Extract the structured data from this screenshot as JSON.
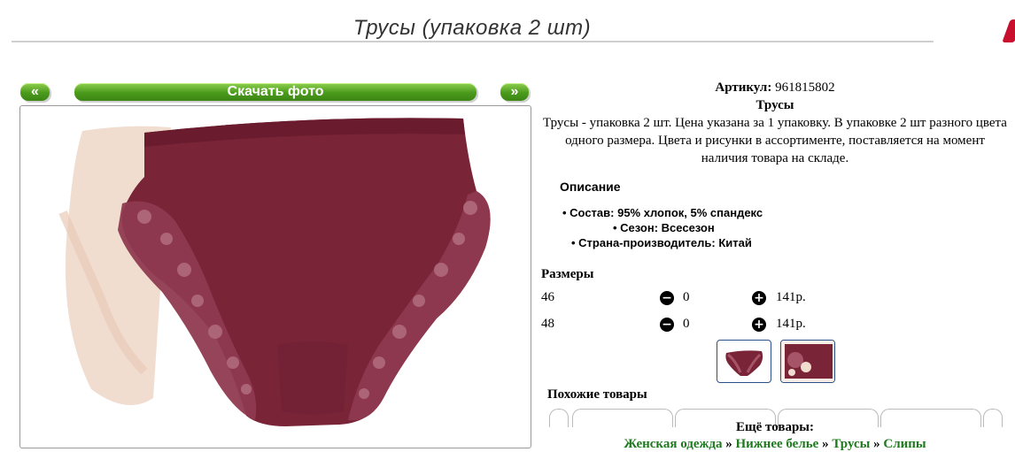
{
  "page_title": "Трусы (упаковка 2 шт)",
  "gallery": {
    "prev_label": "«",
    "download_label": "Скачать фото",
    "next_label": "»"
  },
  "product": {
    "article_label": "Артикул:",
    "article_value": "961815802",
    "name": "Трусы",
    "summary": "Трусы - упаковка 2 шт. Цена указана за 1 упаковку. В упаковке 2 шт разного цвета одного размера. Цвета и рисунки в ассортименте, поставляется на момент наличия товара на складе.",
    "description_heading": "Описание",
    "specs": [
      "Состав: 95% хлопок, 5% спандекс",
      "Сезон: Всесезон",
      "Страна-производитель: Китай"
    ]
  },
  "sizes": {
    "heading": "Размеры",
    "rows": [
      {
        "size": "46",
        "qty": "0",
        "price": "141р."
      },
      {
        "size": "48",
        "qty": "0",
        "price": "141р."
      }
    ],
    "minus_icon": "minus-circle-icon",
    "plus_icon": "plus-circle-icon"
  },
  "similar": {
    "heading": "Похожие товары"
  },
  "more": {
    "heading": "Ещё товары:",
    "breadcrumb": [
      "Женская одежда",
      "Нижнее белье",
      "Трусы",
      "Слипы"
    ],
    "separator": "»"
  },
  "colors": {
    "accent_green": "#4a9a1c",
    "link_green": "#1f7a1f",
    "product_burgundy": "#7a2438",
    "product_beige": "#f1ddd0"
  }
}
